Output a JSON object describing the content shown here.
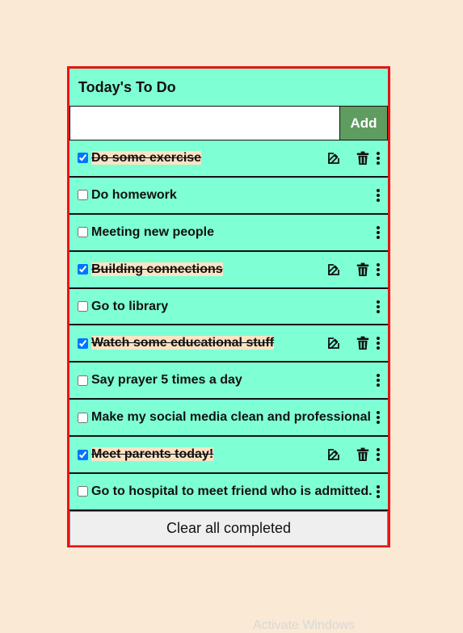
{
  "app": {
    "title": "Today's To Do",
    "input_value": "",
    "input_placeholder": "",
    "add_label": "Add",
    "clear_label": "Clear all completed"
  },
  "tasks": [
    {
      "text": "Do some exercise",
      "completed": true
    },
    {
      "text": "Do homework",
      "completed": false
    },
    {
      "text": "Meeting new people",
      "completed": false
    },
    {
      "text": "Building connections",
      "completed": true
    },
    {
      "text": "Go to library",
      "completed": false
    },
    {
      "text": "Watch some educational stuff",
      "completed": true
    },
    {
      "text": "Say prayer 5 times a day",
      "completed": false
    },
    {
      "text": "Make my social media clean and professional",
      "completed": false
    },
    {
      "text": "Meet parents today!",
      "completed": true
    },
    {
      "text": "Go to hospital to meet friend who is admitted.",
      "completed": false
    }
  ],
  "watermark": "Activate Windows",
  "colors": {
    "page_bg": "#fae9d4",
    "app_bg": "#7fffd4",
    "border_accent": "#e81414",
    "add_button": "#5f9c60",
    "completed_highlight": "#fce3c4"
  },
  "icons": {
    "edit": "edit-icon",
    "delete": "trash-icon",
    "menu": "kebab-menu-icon"
  }
}
